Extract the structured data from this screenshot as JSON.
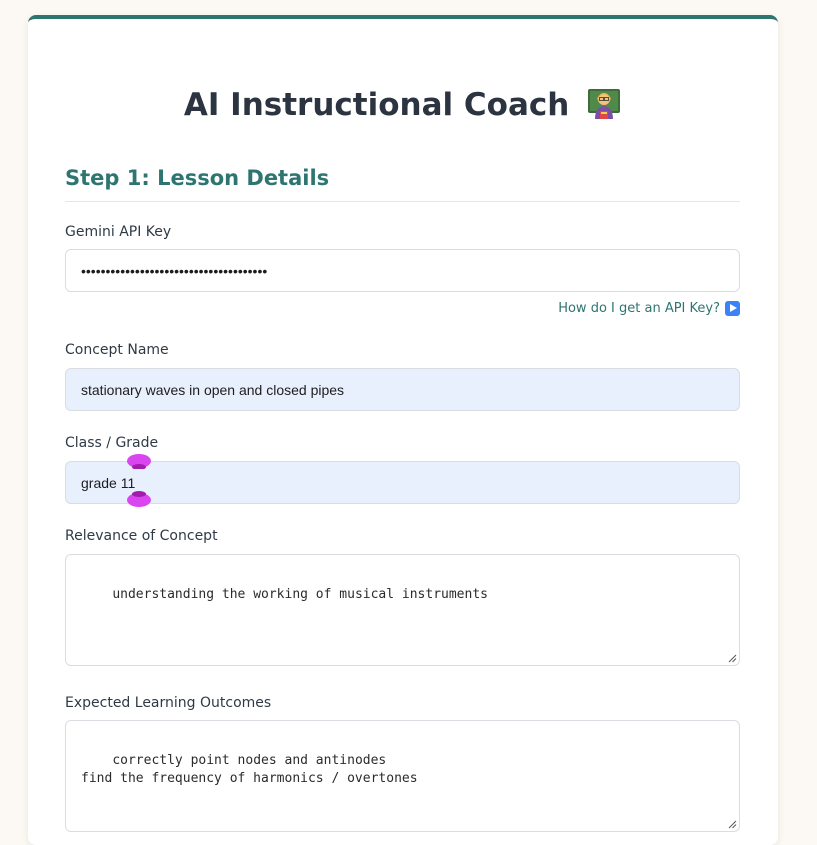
{
  "page": {
    "title": "AI Instructional Coach",
    "title_icon": "teacher-icon",
    "accent_color": "#2e7572"
  },
  "step1": {
    "heading": "Step 1: Lesson Details",
    "api_key": {
      "label": "Gemini API Key",
      "value": "••••••••••••••••••••••••••••••••••••••",
      "help_link": "How do I get an API Key?",
      "help_icon": "play-button-icon"
    },
    "concept": {
      "label": "Concept Name",
      "value": "stationary waves in open and closed pipes"
    },
    "grade": {
      "label": "Class / Grade",
      "value": "grade 11"
    },
    "relevance": {
      "label": "Relevance of Concept",
      "value": "understanding the working of musical instruments"
    },
    "outcomes": {
      "label": "Expected Learning Outcomes",
      "value": "correctly point nodes and antinodes\nfind the frequency of harmonics / overtones"
    }
  }
}
